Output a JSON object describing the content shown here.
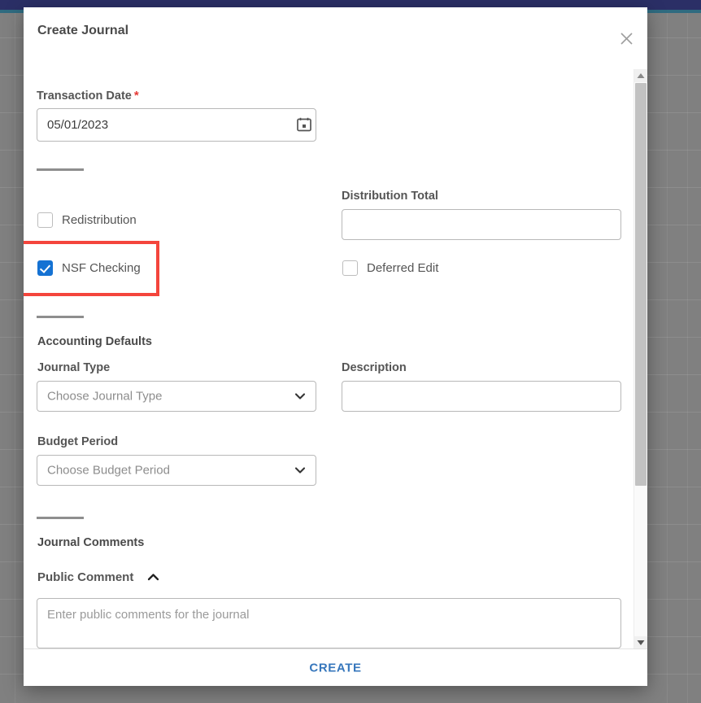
{
  "background": {
    "topbar_color": "#2b2f66",
    "accent_color": "#2f6b80",
    "overlay_color": "#808080"
  },
  "modal": {
    "title": "Create Journal",
    "close_icon": "close-icon",
    "transaction_date": {
      "label": "Transaction Date",
      "required_marker": "*",
      "value": "05/01/2023",
      "icon": "calendar-icon"
    },
    "checkboxes": [
      {
        "label": "Redistribution",
        "checked": false
      },
      {
        "label": "NSF Checking",
        "checked": true
      }
    ],
    "distribution_total": {
      "label": "Distribution Total",
      "value": "",
      "placeholder": ""
    },
    "deferred_edit": {
      "label": "Deferred Edit",
      "checked": false
    },
    "accounting_defaults": {
      "section_title": "Accounting Defaults",
      "journal_type": {
        "label": "Journal Type",
        "selected": "Choose Journal Type",
        "caret_icon": "chevron-down-icon"
      },
      "budget_period": {
        "label": "Budget Period",
        "selected": "Choose Budget Period",
        "caret_icon": "chevron-down-icon"
      },
      "description": {
        "label": "Description",
        "value": "",
        "placeholder": ""
      }
    },
    "journal_comments": {
      "section_title": "Journal Comments",
      "public_comment": {
        "label": "Public Comment",
        "caret_icon": "chevron-up-icon",
        "value": "",
        "placeholder": "Enter public comments for the journal"
      }
    },
    "footer": {
      "create_label": "CREATE",
      "create_color": "#3777bc"
    },
    "scrollbar": {
      "up_icon": "triangle-up-icon",
      "down_icon": "triangle-down-icon"
    }
  },
  "annotation": {
    "highlight_color": "#f4453c",
    "highlight_target": "NSF Checking"
  }
}
